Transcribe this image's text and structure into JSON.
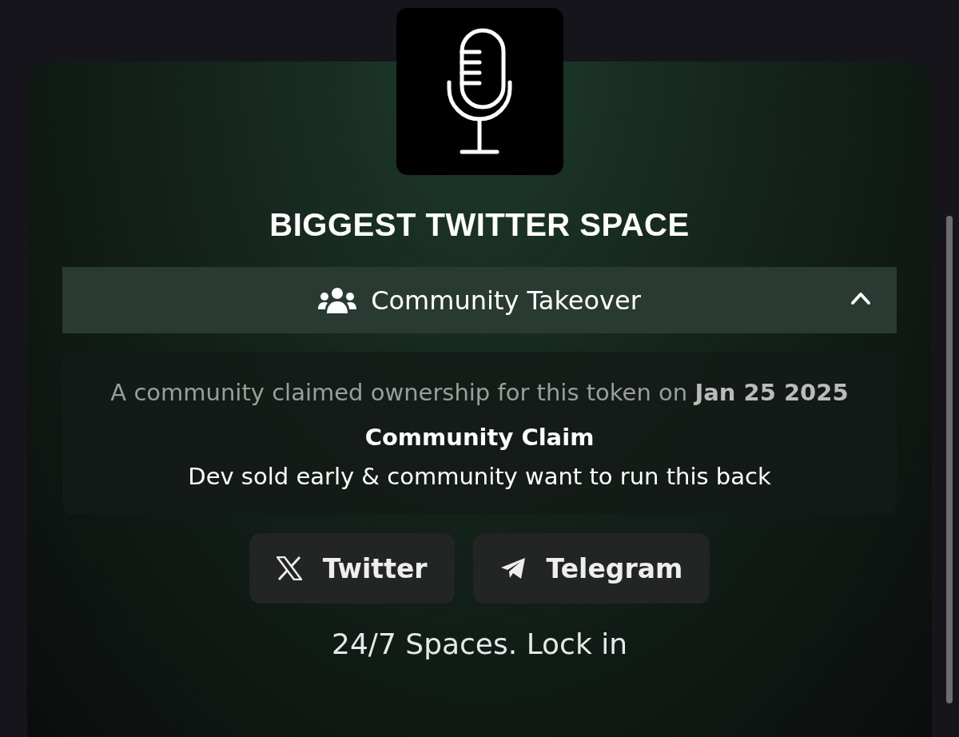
{
  "token": {
    "title": "BIGGEST TWITTER SPACE"
  },
  "takeover": {
    "label": "Community Takeover",
    "expanded": true,
    "claim_sentence": "A community claimed ownership for this token on **Jan 25 2025**",
    "claim_title": "Community Claim",
    "claim_text": "Dev sold early & community want to run this back"
  },
  "links": [
    {
      "kind": "x",
      "label": "Twitter"
    },
    {
      "kind": "telegram",
      "label": "Telegram"
    }
  ],
  "description": "24/7 Spaces. Lock in"
}
